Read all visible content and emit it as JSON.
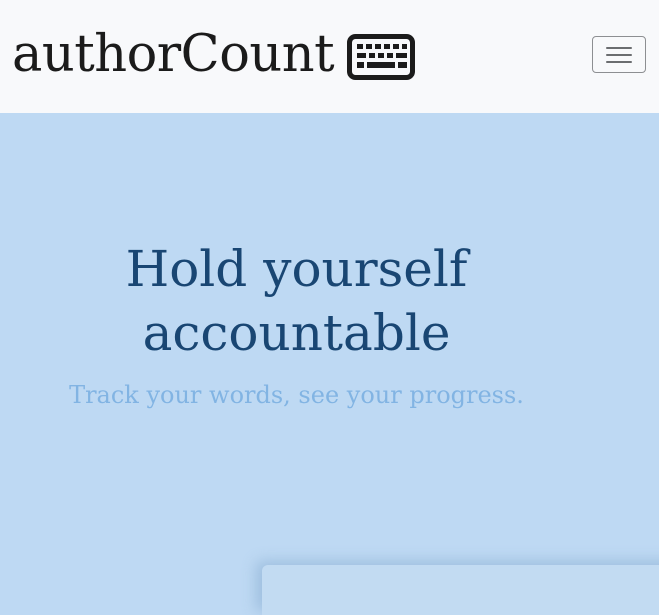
{
  "navbar": {
    "brand": "authorCount",
    "brand_icon": "keyboard-icon",
    "toggler_icon": "hamburger-menu-icon"
  },
  "hero": {
    "title": "Hold yourself accountable",
    "subtitle": "Track your words, see your progress."
  },
  "colors": {
    "navbar_background": "#f8f9fb",
    "hero_background": "#bed9f3",
    "title_color": "#194673",
    "subtitle_color": "#82b4e3",
    "brand_color": "#1b1b1b"
  }
}
